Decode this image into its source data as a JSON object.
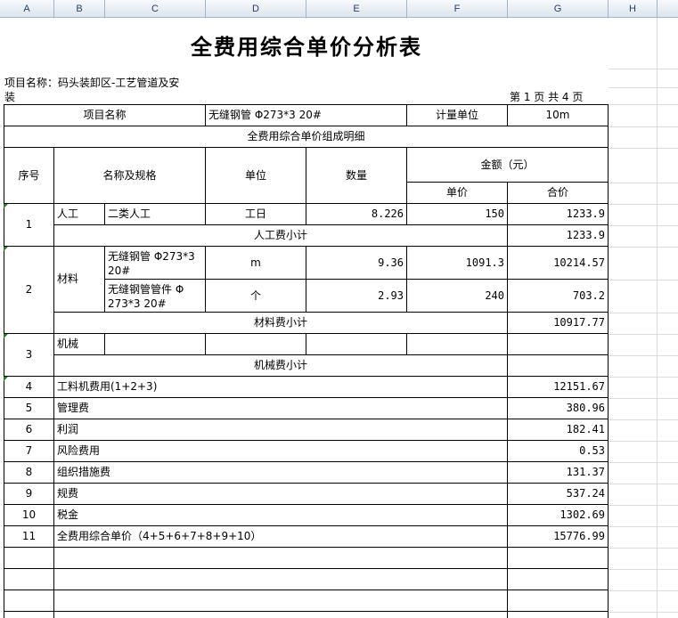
{
  "columns": [
    "A",
    "B",
    "C",
    "D",
    "E",
    "F",
    "G",
    "H"
  ],
  "title": "全费用综合单价分析表",
  "project": {
    "label_line1": "项目名称：码头装卸区-工艺管道及安",
    "label_line2": "装",
    "page_info": "第 1 页  共 4 页"
  },
  "header": {
    "item_name_label": "项目名称",
    "item_name_value": "无缝钢管 Φ273*3 20#",
    "unit_label": "计量单位",
    "unit_value": "10m",
    "composition_title": "全费用综合单价组成明细",
    "seq": "序号",
    "name_spec": "名称及规格",
    "unit": "单位",
    "quantity": "数量",
    "amount": "金额（元）",
    "unit_price": "单价",
    "total": "合价"
  },
  "labor": {
    "seq": "1",
    "category": "人工",
    "name": "二类人工",
    "unit": "工日",
    "quantity": "8.226",
    "unit_price": "150",
    "total": "1233.9",
    "subtotal_label": "人工费小计",
    "subtotal": "1233.9"
  },
  "material": {
    "seq": "2",
    "category": "材料",
    "items": [
      {
        "name": "无缝钢管 Φ273*3 20#",
        "unit": "m",
        "quantity": "9.36",
        "unit_price": "1091.3",
        "total": "10214.57"
      },
      {
        "name": "无缝钢管管件 Φ 273*3 20#",
        "unit": "个",
        "quantity": "2.93",
        "unit_price": "240",
        "total": "703.2"
      }
    ],
    "subtotal_label": "材料费小计",
    "subtotal": "10917.77"
  },
  "machinery": {
    "seq": "3",
    "category": "机械",
    "subtotal_label": "机械费小计"
  },
  "summary": [
    {
      "seq": "4",
      "label": "工料机费用(1+2+3)",
      "value": "12151.67"
    },
    {
      "seq": "5",
      "label": "管理费",
      "value": "380.96"
    },
    {
      "seq": "6",
      "label": "利润",
      "value": "182.41"
    },
    {
      "seq": "7",
      "label": "风险费用",
      "value": "0.53"
    },
    {
      "seq": "8",
      "label": "组织措施费",
      "value": "131.37"
    },
    {
      "seq": "9",
      "label": "规费",
      "value": "537.24"
    },
    {
      "seq": "10",
      "label": "税金",
      "value": "1302.69"
    },
    {
      "seq": "11",
      "label": "全费用综合单价（4+5+6+7+8+9+10）",
      "value": "15776.99"
    }
  ]
}
